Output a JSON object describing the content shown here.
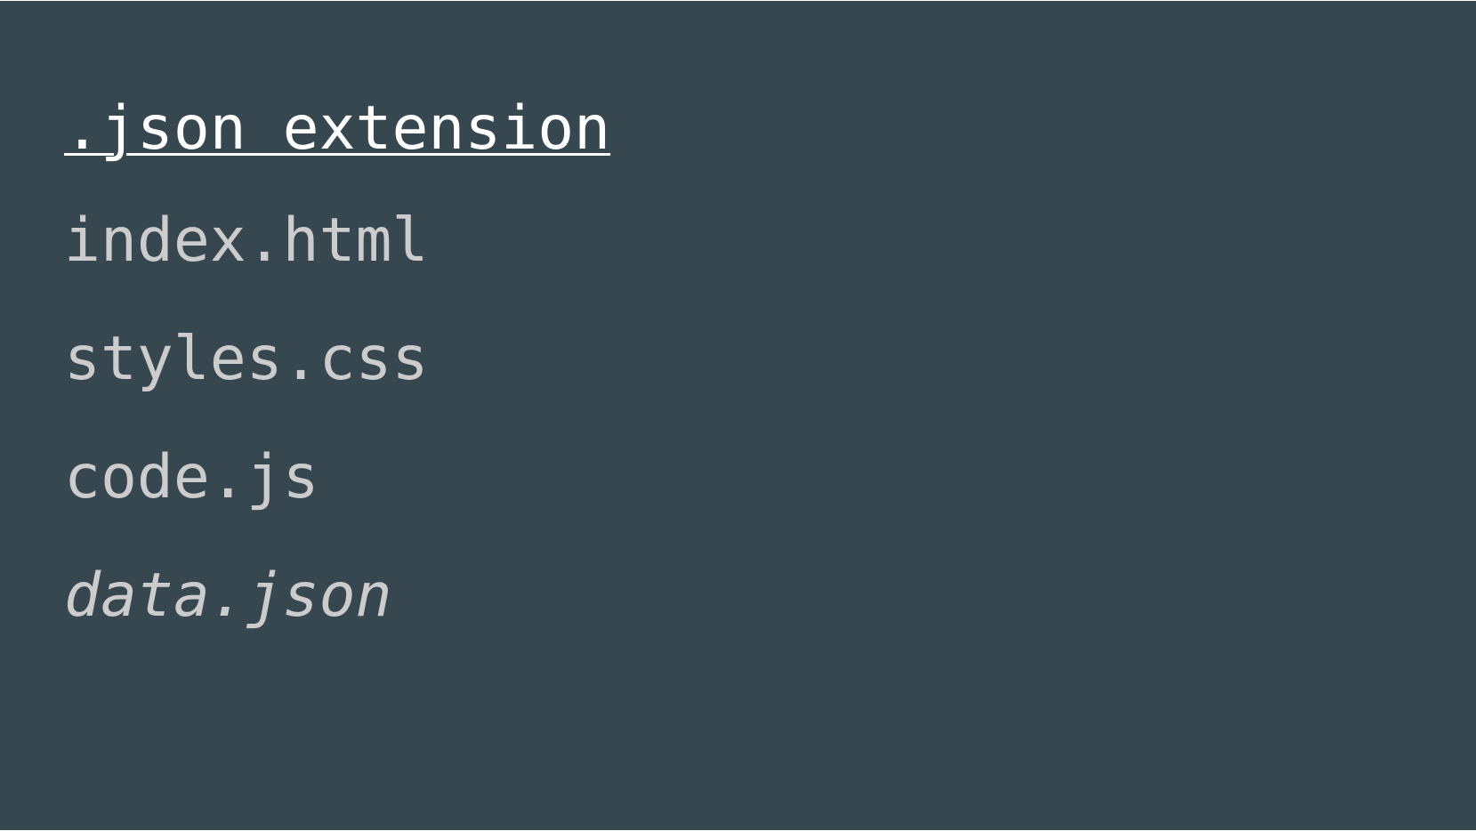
{
  "heading": ".json extension",
  "files": [
    "index.html",
    "styles.css",
    "code.js",
    "data.json"
  ],
  "colors": {
    "background": "#36474f",
    "heading": "#ffffff",
    "text": "#cccccc"
  }
}
